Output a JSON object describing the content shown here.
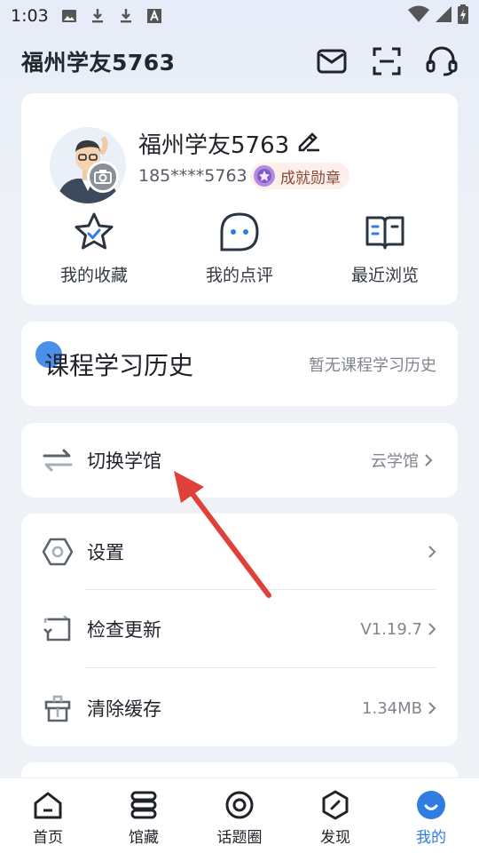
{
  "status_bar": {
    "time": "1:03"
  },
  "header": {
    "title": "福州学友5763"
  },
  "profile": {
    "name": "福州学友5763",
    "phone": "185****5763",
    "badge_label": "成就勋章",
    "quick_actions": [
      {
        "label": "我的收藏",
        "icon": "star-icon"
      },
      {
        "label": "我的点评",
        "icon": "comment-icon"
      },
      {
        "label": "最近浏览",
        "icon": "book-icon"
      }
    ]
  },
  "course": {
    "title": "课程学习历史",
    "empty_text": "暂无课程学习历史"
  },
  "switch_library": {
    "label": "切换学馆",
    "value": "云学馆"
  },
  "settings": [
    {
      "label": "设置",
      "value": "",
      "icon": "hexagon-settings-icon"
    },
    {
      "label": "检查更新",
      "value": "V1.19.7",
      "icon": "update-icon"
    },
    {
      "label": "清除缓存",
      "value": "1.34MB",
      "icon": "trash-icon"
    }
  ],
  "bottom_nav": [
    {
      "label": "首页",
      "icon": "home-icon"
    },
    {
      "label": "馆藏",
      "icon": "collection-icon"
    },
    {
      "label": "话题圈",
      "icon": "topic-circle-icon"
    },
    {
      "label": "发现",
      "icon": "discover-icon"
    },
    {
      "label": "我的",
      "icon": "profile-icon",
      "active": true
    }
  ],
  "colors": {
    "accent": "#2f7de1",
    "annotation_arrow": "#e0403a"
  }
}
